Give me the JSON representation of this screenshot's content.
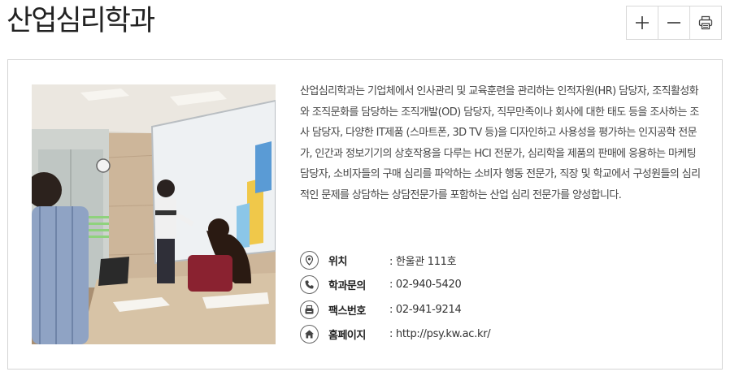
{
  "page": {
    "title": "산업심리학과"
  },
  "toolbar": {
    "zoom_in_icon": "plus-icon",
    "zoom_out_icon": "minus-icon",
    "print_icon": "printer-icon"
  },
  "department": {
    "photo_alt": "",
    "description": "산업심리학과는 기업체에서 인사관리 및 교육훈련을 관리하는 인적자원(HR) 담당자, 조직활성화와 조직문화를 담당하는 조직개발(OD) 담당자, 직무만족이나 회사에 대한 태도 등을 조사하는 조사 담당자, 다양한 IT제품 (스마트폰, 3D TV 등)을 디자인하고 사용성을 평가하는 인지공학 전문가, 인간과 정보기기의 상호작용을 다루는 HCI 전문가, 심리학을 제품의 판매에 응용하는 마케팅 담당자, 소비자들의 구매 심리를 파악하는 소비자 행동 전문가, 직장 및 학교에서 구성원들의 심리적인 문제를 상담하는 상담전문가를 포함하는 산업 심리 전문가를 양성합니다.",
    "info": [
      {
        "icon": "location-pin-icon",
        "label": "위치",
        "value": ": 한울관 111호"
      },
      {
        "icon": "phone-icon",
        "label": "학과문의",
        "value": ": 02-940-5420"
      },
      {
        "icon": "fax-icon",
        "label": "팩스번호",
        "value": ": 02-941-9214"
      },
      {
        "icon": "home-icon",
        "label": "홈페이지",
        "value": ": http://psy.kw.ac.kr/"
      }
    ]
  }
}
